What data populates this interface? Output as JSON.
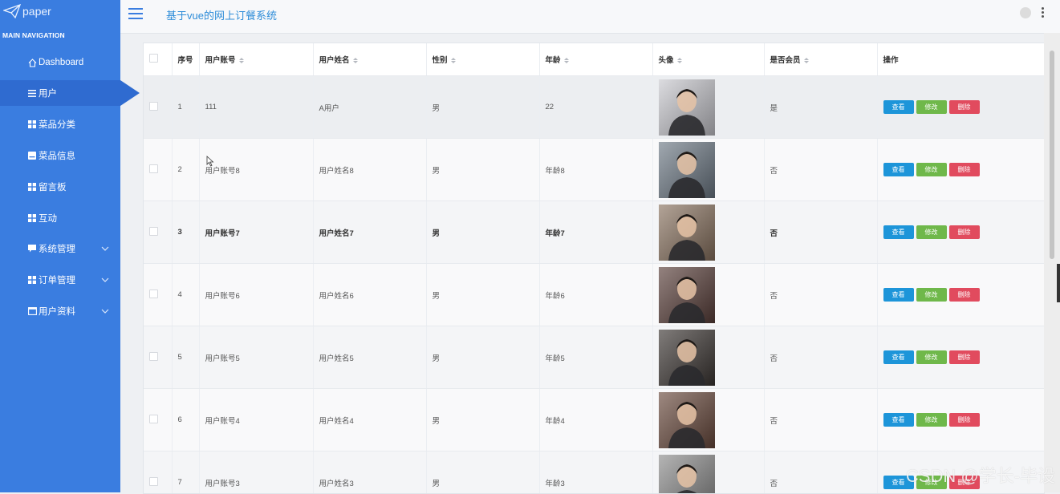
{
  "sidebar": {
    "logo_text": "paper",
    "nav_heading": "MAIN NAVIGATION",
    "items": [
      {
        "label": "Dashboard",
        "icon": "home-icon",
        "active": false,
        "has_chevron": false
      },
      {
        "label": "用户",
        "icon": "list-icon",
        "active": true,
        "has_chevron": false
      },
      {
        "label": "菜品分类",
        "icon": "grid-icon",
        "active": false,
        "has_chevron": false
      },
      {
        "label": "菜品信息",
        "icon": "card-icon",
        "active": false,
        "has_chevron": false
      },
      {
        "label": "留言板",
        "icon": "grid-icon",
        "active": false,
        "has_chevron": false
      },
      {
        "label": "互动",
        "icon": "grid-icon",
        "active": false,
        "has_chevron": false
      },
      {
        "label": "系统管理",
        "icon": "comment-icon",
        "active": false,
        "has_chevron": true
      },
      {
        "label": "订单管理",
        "icon": "grid-icon",
        "active": false,
        "has_chevron": true
      },
      {
        "label": "用户资料",
        "icon": "window-icon",
        "active": false,
        "has_chevron": true
      }
    ]
  },
  "header": {
    "title": "基于vue的网上订餐系统"
  },
  "table": {
    "columns": [
      {
        "label": "",
        "sortable": false
      },
      {
        "label": "序号",
        "sortable": false
      },
      {
        "label": "用户账号",
        "sortable": true
      },
      {
        "label": "用户姓名",
        "sortable": true
      },
      {
        "label": "性别",
        "sortable": true
      },
      {
        "label": "年龄",
        "sortable": true
      },
      {
        "label": "头像",
        "sortable": true
      },
      {
        "label": "是否会员",
        "sortable": true
      },
      {
        "label": "操作",
        "sortable": false
      }
    ],
    "rows": [
      {
        "index": "1",
        "account": "111",
        "name": "A用户",
        "gender": "男",
        "age": "22",
        "member": "是",
        "avatar_color": "#c9c9cf"
      },
      {
        "index": "2",
        "account": "用户账号8",
        "name": "用户姓名8",
        "gender": "男",
        "age": "年龄8",
        "member": "否",
        "avatar_color": "#6e7a86"
      },
      {
        "index": "3",
        "account": "用户账号7",
        "name": "用户姓名7",
        "gender": "男",
        "age": "年龄7",
        "member": "否",
        "avatar_color": "#8a7360"
      },
      {
        "index": "4",
        "account": "用户账号6",
        "name": "用户姓名6",
        "gender": "男",
        "age": "年龄6",
        "member": "否",
        "avatar_color": "#5a3f3a"
      },
      {
        "index": "5",
        "account": "用户账号5",
        "name": "用户姓名5",
        "gender": "男",
        "age": "年龄5",
        "member": "否",
        "avatar_color": "#3c3633"
      },
      {
        "index": "6",
        "account": "用户账号4",
        "name": "用户姓名4",
        "gender": "男",
        "age": "年龄4",
        "member": "否",
        "avatar_color": "#6a4a3d"
      },
      {
        "index": "7",
        "account": "用户账号3",
        "name": "用户姓名3",
        "gender": "男",
        "age": "年龄3",
        "member": "否",
        "avatar_color": "#8d8d8d"
      }
    ],
    "actions": {
      "view": "查看",
      "edit": "修改",
      "delete": "删除"
    }
  },
  "watermark": "CSDN @学长-毕设",
  "colors": {
    "sidebar": "#3a7de0",
    "sidebar_active": "#2f6bd0",
    "title": "#2d8cd8",
    "btn_view": "#1d95d9",
    "btn_edit": "#6fb84a",
    "btn_delete": "#e14b5e"
  }
}
